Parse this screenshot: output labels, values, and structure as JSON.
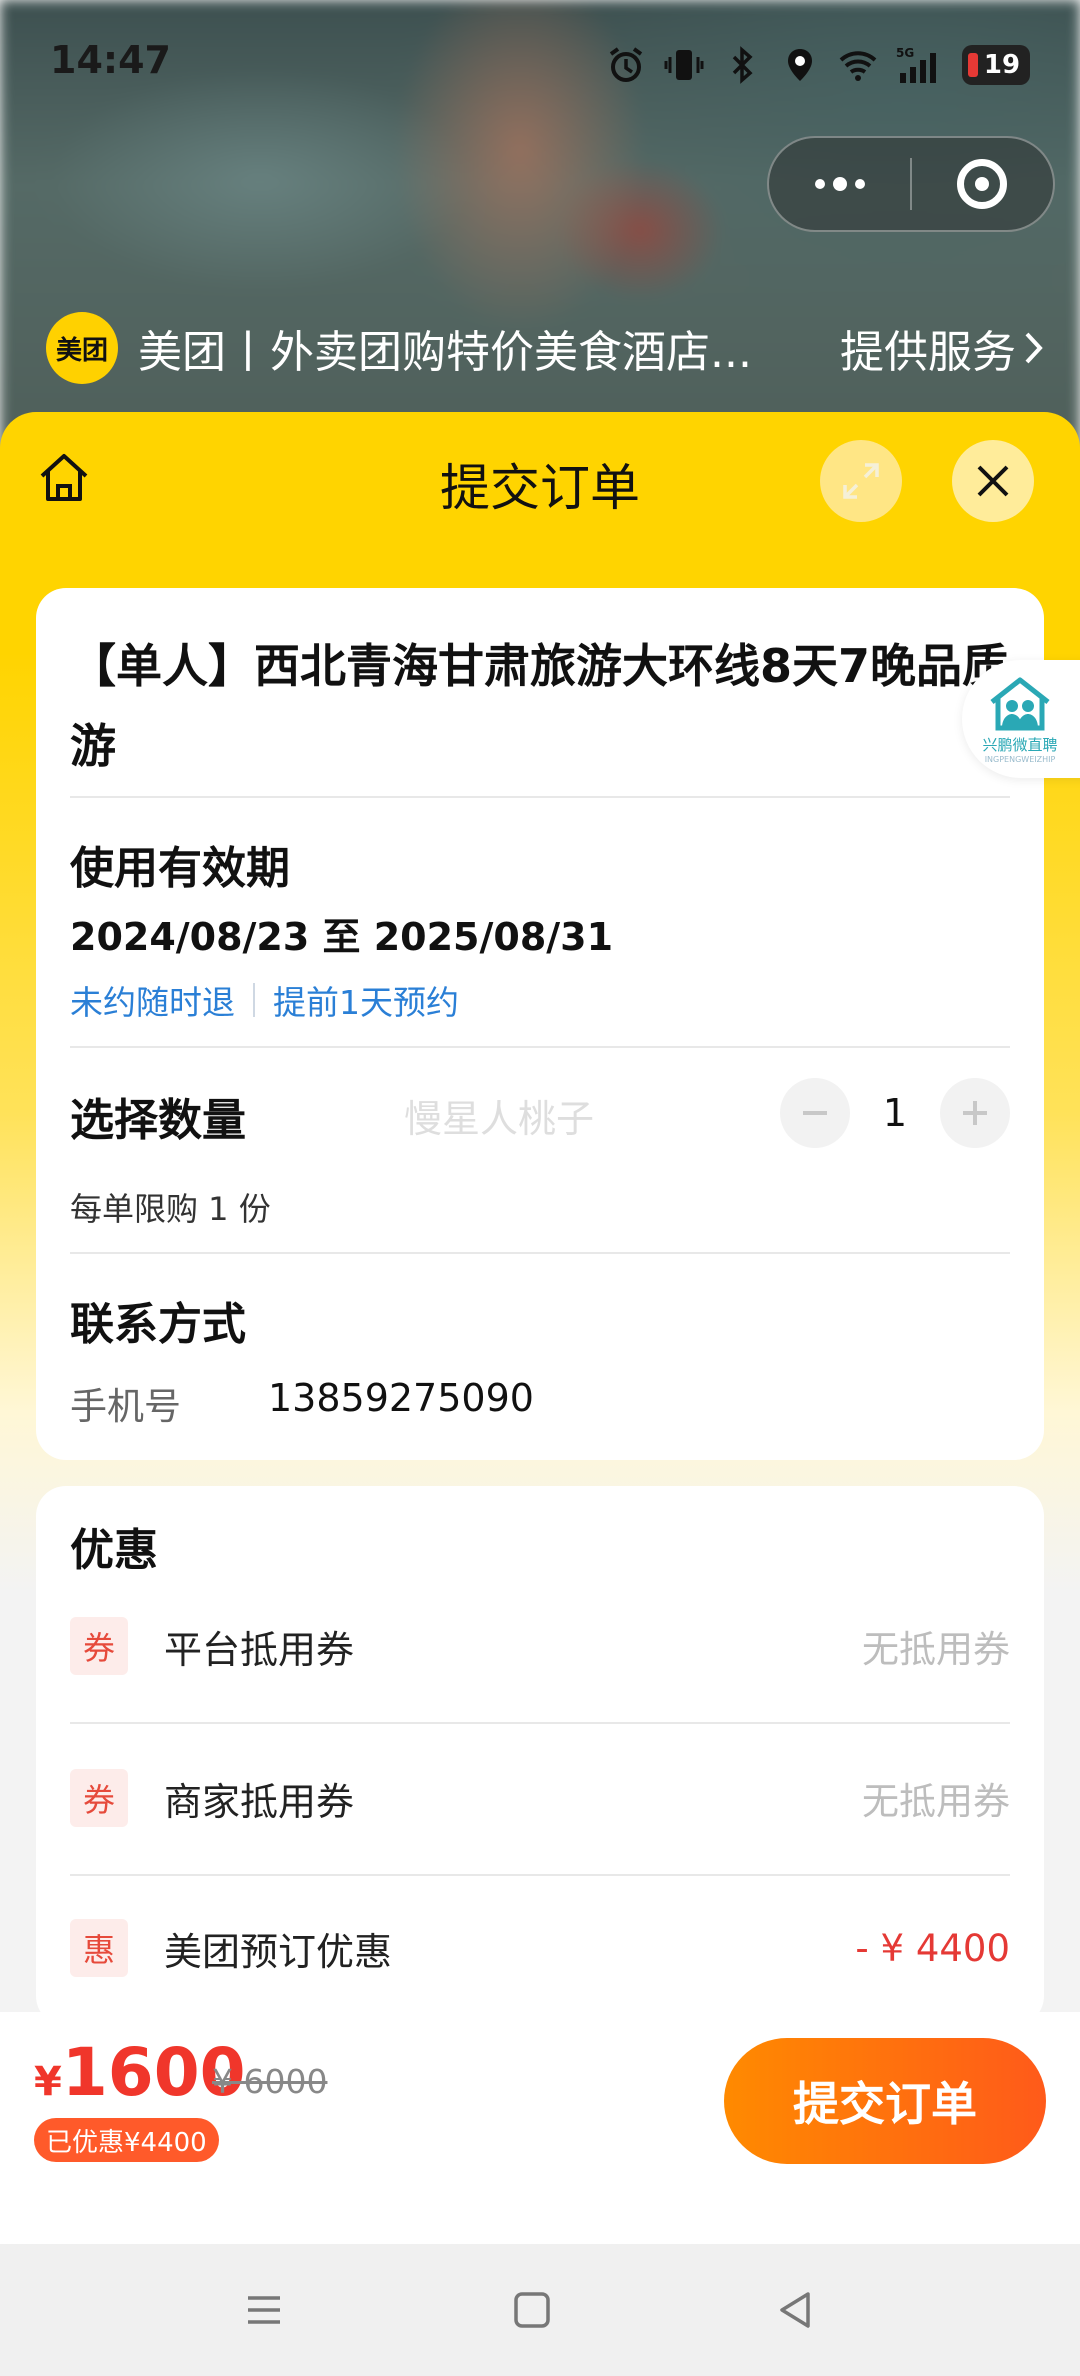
{
  "status_bar": {
    "time": "14:47",
    "battery": "19",
    "network": "5G"
  },
  "mini_program": {
    "logo_text": "美团",
    "name": "美团丨外卖团购特价美食酒店...",
    "service_link": "提供服务"
  },
  "sheet": {
    "title": "提交订单"
  },
  "product": {
    "title": "【单人】西北青海甘肃旅游大环线8天7晚品质游"
  },
  "validity": {
    "label": "使用有效期",
    "dates": "2024/08/23 至 2025/08/31",
    "tag_1": "未约随时退",
    "tag_2": "提前1天预约"
  },
  "quantity": {
    "label": "选择数量",
    "value": "1",
    "limit_text": "每单限购 1 份",
    "watermark": "慢星人桃子"
  },
  "contact": {
    "label": "联系方式",
    "phone_label": "手机号",
    "phone_value": "13859275090"
  },
  "discounts": {
    "label": "优惠",
    "items": [
      {
        "badge": "券",
        "name": "平台抵用券",
        "value": "无抵用券",
        "highlight": false
      },
      {
        "badge": "券",
        "name": "商家抵用券",
        "value": "无抵用券",
        "highlight": false
      },
      {
        "badge": "惠",
        "name": "美团预订优惠",
        "value": "- ¥ 4400",
        "highlight": true
      }
    ]
  },
  "order_bar": {
    "currency": "¥",
    "price": "1600",
    "original_price": "¥ 6000",
    "saved": "已优惠¥4400",
    "submit": "提交订单"
  },
  "side_widget": {
    "label": "兴鹏微直聘",
    "sub_label": "INGPENGWEIZHIP"
  },
  "colors": {
    "brand_yellow": "#ffd400",
    "price_red": "#f0362b",
    "submit_orange": "#ff6a10",
    "link_blue": "#2a7fd6"
  }
}
